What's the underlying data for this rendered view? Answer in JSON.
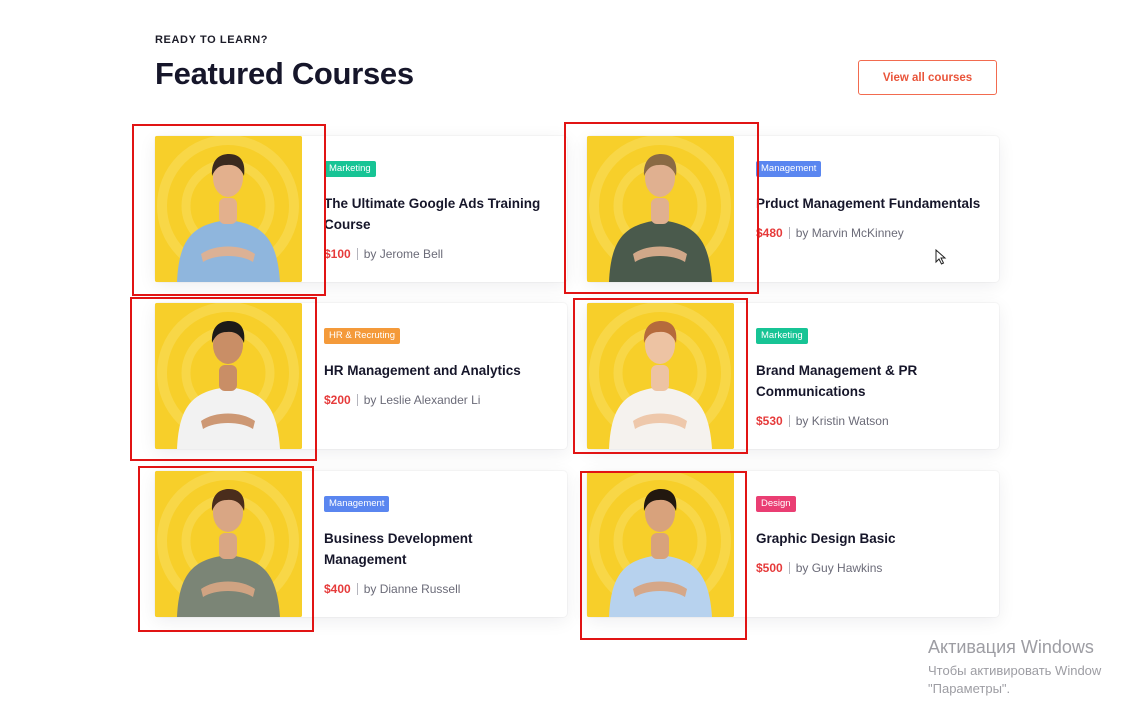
{
  "header": {
    "eyebrow": "READY TO LEARN?",
    "title": "Featured Courses",
    "view_all_label": "View all courses"
  },
  "courses": [
    {
      "tag": "Marketing",
      "tag_color": "#17c495",
      "title": "The Ultimate Google Ads Training Course",
      "price": "$100",
      "author": "by Jerome Bell",
      "shirt": "#8fb6dd",
      "hair": "#3b2a1e",
      "skin": "#e3b08d"
    },
    {
      "tag": "Management",
      "tag_color": "#5a86f0",
      "title": "Prduct Management Fundamentals",
      "price": "$480",
      "author": "by Marvin McKinney",
      "shirt": "#4a5a4c",
      "hair": "#8a6a44",
      "skin": "#e0b090"
    },
    {
      "tag": "HR & Recruting",
      "tag_color": "#f49a3a",
      "title": "HR  Management and Analytics",
      "price": "$200",
      "author": "by Leslie Alexander Li",
      "shirt": "#f2f2f2",
      "hair": "#1d1a18",
      "skin": "#c98e66"
    },
    {
      "tag": "Marketing",
      "tag_color": "#17c495",
      "title": "Brand Management & PR Communications",
      "price": "$530",
      "author": "by Kristin Watson",
      "shirt": "#f5f2ee",
      "hair": "#b56a3c",
      "skin": "#edc3a3"
    },
    {
      "tag": "Management",
      "tag_color": "#5a86f0",
      "title": "Business Development Management",
      "price": "$400",
      "author": "by Dianne Russell",
      "shirt": "#7b8576",
      "hair": "#4a2d1c",
      "skin": "#d9a684"
    },
    {
      "tag": "Design",
      "tag_color": "#ea3e73",
      "title": "Graphic Design Basic",
      "price": "$500",
      "author": "by Guy Hawkins",
      "shirt": "#b7d2ee",
      "hair": "#22180f",
      "skin": "#d8a27c"
    }
  ],
  "watermark": {
    "line1": "Активация Windows",
    "line2": "Чтобы активировать Window",
    "line3": "\"Параметры\"."
  }
}
